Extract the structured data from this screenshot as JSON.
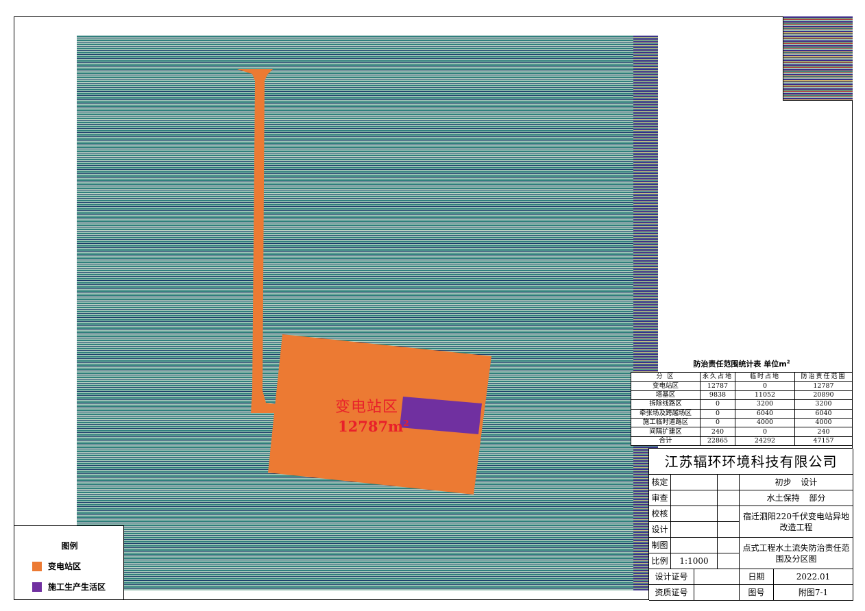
{
  "map": {
    "zone_label": "变电站区",
    "zone_area_value": "12787m",
    "zone_area_unit_power": "2",
    "colors": {
      "substation_zone": "#ec7a33",
      "construction_living_zone": "#7030a0",
      "label_red": "#e8202a"
    }
  },
  "stats_table": {
    "title": "防治责任范围统计表 单位m",
    "title_power": "2",
    "headers": [
      "分 区",
      "永久占地",
      "临时占地",
      "防治责任范围"
    ],
    "rows": [
      [
        "变电站区",
        "12787",
        "0",
        "12787"
      ],
      [
        "塔基区",
        "9838",
        "11052",
        "20890"
      ],
      [
        "拆除线路区",
        "0",
        "3200",
        "3200"
      ],
      [
        "牵张场及跨越场区",
        "0",
        "6040",
        "6040"
      ],
      [
        "施工临时道路区",
        "0",
        "4000",
        "4000"
      ],
      [
        "间隔扩建区",
        "240",
        "0",
        "240"
      ],
      [
        "合计",
        "22865",
        "24292",
        "47157"
      ]
    ]
  },
  "title_block": {
    "company": "江苏辐环环境科技有限公司",
    "labels": {
      "approve": "核定",
      "review": "审查",
      "check": "校核",
      "design": "设计",
      "draw": "制图",
      "scale": "比例",
      "design_cert": "设计证号",
      "qual_cert": "资质证号",
      "date": "日期",
      "figure_no": "图号"
    },
    "scale_value": "1:1000",
    "stage": "初步 设计",
    "section": "水土保持 部分",
    "project": "宿迁泗阳220千伏变电站异地改造工程",
    "drawing_title": "点式工程水土流失防治责任范围及分区图",
    "date_value": "2022.01",
    "figure_value": "附图7-1"
  },
  "legend": {
    "title": "图例",
    "items": [
      {
        "label": "变电站区",
        "color": "#ec7a33"
      },
      {
        "label": "施工生产生活区",
        "color": "#7030a0"
      }
    ]
  }
}
